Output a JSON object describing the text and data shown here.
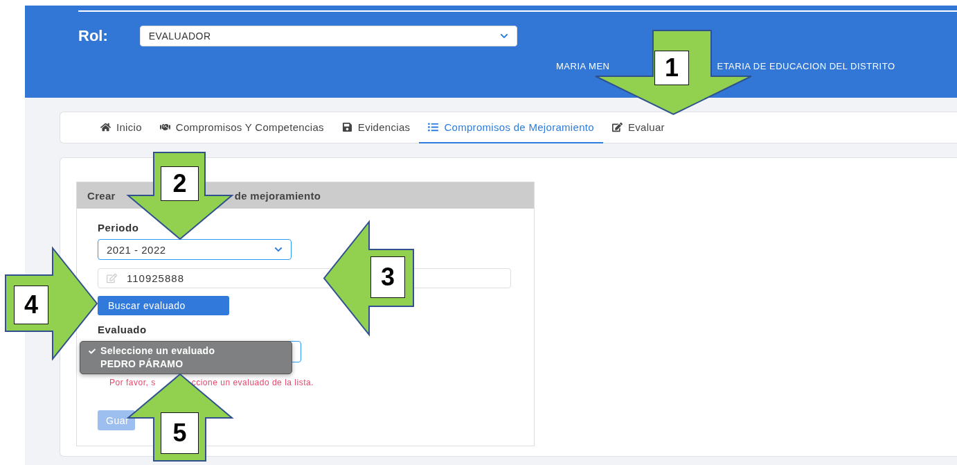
{
  "header": {
    "role_label": "Rol:",
    "role_select": {
      "value": "EVALUADOR"
    },
    "user_text_parts": [
      "MARIA MEN",
      "ETARIA DE EDUCACION DEL DISTRITO"
    ]
  },
  "tabs": [
    {
      "label": "Inicio",
      "selected": false
    },
    {
      "label": "Compromisos Y Competencias",
      "selected": false
    },
    {
      "label": "Evidencias",
      "selected": false
    },
    {
      "label": "Compromisos de Mejoramiento",
      "selected": true
    },
    {
      "label": "Evaluar",
      "selected": false
    }
  ],
  "form": {
    "title_parts": [
      "Crear",
      "de mejoramiento"
    ],
    "period_label": "Periodo",
    "period_select": {
      "value": "2021 - 2022"
    },
    "id_input": {
      "value": "110925888"
    },
    "search_button": "Buscar evaluado",
    "evaluated_label": "Evaluado",
    "evaluated_options": [
      {
        "label": "Seleccione un evaluado",
        "selected": true
      },
      {
        "label": "PEDRO PÁRAMO",
        "selected": false
      }
    ],
    "error_parts": [
      "Por favor, s",
      "ccione un evaluado de la lista."
    ],
    "save_button": {
      "label": "Guar",
      "disabled": true
    }
  },
  "annotations": [
    {
      "number": "1"
    },
    {
      "number": "2"
    },
    {
      "number": "3"
    },
    {
      "number": "4"
    },
    {
      "number": "5"
    }
  ]
}
